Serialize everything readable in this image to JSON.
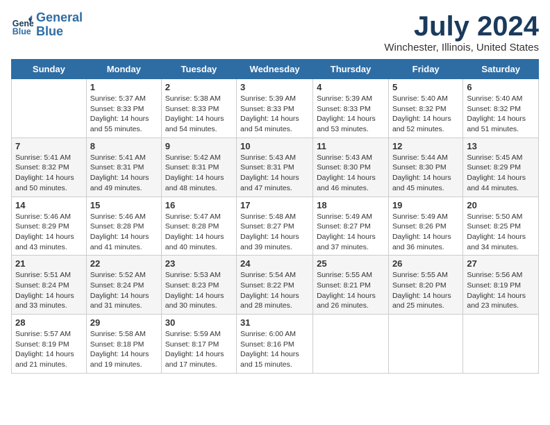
{
  "header": {
    "logo_line1": "General",
    "logo_line2": "Blue",
    "main_title": "July 2024",
    "subtitle": "Winchester, Illinois, United States"
  },
  "weekdays": [
    "Sunday",
    "Monday",
    "Tuesday",
    "Wednesday",
    "Thursday",
    "Friday",
    "Saturday"
  ],
  "weeks": [
    [
      {
        "day": "",
        "info": ""
      },
      {
        "day": "1",
        "info": "Sunrise: 5:37 AM\nSunset: 8:33 PM\nDaylight: 14 hours\nand 55 minutes."
      },
      {
        "day": "2",
        "info": "Sunrise: 5:38 AM\nSunset: 8:33 PM\nDaylight: 14 hours\nand 54 minutes."
      },
      {
        "day": "3",
        "info": "Sunrise: 5:39 AM\nSunset: 8:33 PM\nDaylight: 14 hours\nand 54 minutes."
      },
      {
        "day": "4",
        "info": "Sunrise: 5:39 AM\nSunset: 8:33 PM\nDaylight: 14 hours\nand 53 minutes."
      },
      {
        "day": "5",
        "info": "Sunrise: 5:40 AM\nSunset: 8:32 PM\nDaylight: 14 hours\nand 52 minutes."
      },
      {
        "day": "6",
        "info": "Sunrise: 5:40 AM\nSunset: 8:32 PM\nDaylight: 14 hours\nand 51 minutes."
      }
    ],
    [
      {
        "day": "7",
        "info": "Sunrise: 5:41 AM\nSunset: 8:32 PM\nDaylight: 14 hours\nand 50 minutes."
      },
      {
        "day": "8",
        "info": "Sunrise: 5:41 AM\nSunset: 8:31 PM\nDaylight: 14 hours\nand 49 minutes."
      },
      {
        "day": "9",
        "info": "Sunrise: 5:42 AM\nSunset: 8:31 PM\nDaylight: 14 hours\nand 48 minutes."
      },
      {
        "day": "10",
        "info": "Sunrise: 5:43 AM\nSunset: 8:31 PM\nDaylight: 14 hours\nand 47 minutes."
      },
      {
        "day": "11",
        "info": "Sunrise: 5:43 AM\nSunset: 8:30 PM\nDaylight: 14 hours\nand 46 minutes."
      },
      {
        "day": "12",
        "info": "Sunrise: 5:44 AM\nSunset: 8:30 PM\nDaylight: 14 hours\nand 45 minutes."
      },
      {
        "day": "13",
        "info": "Sunrise: 5:45 AM\nSunset: 8:29 PM\nDaylight: 14 hours\nand 44 minutes."
      }
    ],
    [
      {
        "day": "14",
        "info": "Sunrise: 5:46 AM\nSunset: 8:29 PM\nDaylight: 14 hours\nand 43 minutes."
      },
      {
        "day": "15",
        "info": "Sunrise: 5:46 AM\nSunset: 8:28 PM\nDaylight: 14 hours\nand 41 minutes."
      },
      {
        "day": "16",
        "info": "Sunrise: 5:47 AM\nSunset: 8:28 PM\nDaylight: 14 hours\nand 40 minutes."
      },
      {
        "day": "17",
        "info": "Sunrise: 5:48 AM\nSunset: 8:27 PM\nDaylight: 14 hours\nand 39 minutes."
      },
      {
        "day": "18",
        "info": "Sunrise: 5:49 AM\nSunset: 8:27 PM\nDaylight: 14 hours\nand 37 minutes."
      },
      {
        "day": "19",
        "info": "Sunrise: 5:49 AM\nSunset: 8:26 PM\nDaylight: 14 hours\nand 36 minutes."
      },
      {
        "day": "20",
        "info": "Sunrise: 5:50 AM\nSunset: 8:25 PM\nDaylight: 14 hours\nand 34 minutes."
      }
    ],
    [
      {
        "day": "21",
        "info": "Sunrise: 5:51 AM\nSunset: 8:24 PM\nDaylight: 14 hours\nand 33 minutes."
      },
      {
        "day": "22",
        "info": "Sunrise: 5:52 AM\nSunset: 8:24 PM\nDaylight: 14 hours\nand 31 minutes."
      },
      {
        "day": "23",
        "info": "Sunrise: 5:53 AM\nSunset: 8:23 PM\nDaylight: 14 hours\nand 30 minutes."
      },
      {
        "day": "24",
        "info": "Sunrise: 5:54 AM\nSunset: 8:22 PM\nDaylight: 14 hours\nand 28 minutes."
      },
      {
        "day": "25",
        "info": "Sunrise: 5:55 AM\nSunset: 8:21 PM\nDaylight: 14 hours\nand 26 minutes."
      },
      {
        "day": "26",
        "info": "Sunrise: 5:55 AM\nSunset: 8:20 PM\nDaylight: 14 hours\nand 25 minutes."
      },
      {
        "day": "27",
        "info": "Sunrise: 5:56 AM\nSunset: 8:19 PM\nDaylight: 14 hours\nand 23 minutes."
      }
    ],
    [
      {
        "day": "28",
        "info": "Sunrise: 5:57 AM\nSunset: 8:19 PM\nDaylight: 14 hours\nand 21 minutes."
      },
      {
        "day": "29",
        "info": "Sunrise: 5:58 AM\nSunset: 8:18 PM\nDaylight: 14 hours\nand 19 minutes."
      },
      {
        "day": "30",
        "info": "Sunrise: 5:59 AM\nSunset: 8:17 PM\nDaylight: 14 hours\nand 17 minutes."
      },
      {
        "day": "31",
        "info": "Sunrise: 6:00 AM\nSunset: 8:16 PM\nDaylight: 14 hours\nand 15 minutes."
      },
      {
        "day": "",
        "info": ""
      },
      {
        "day": "",
        "info": ""
      },
      {
        "day": "",
        "info": ""
      }
    ]
  ]
}
